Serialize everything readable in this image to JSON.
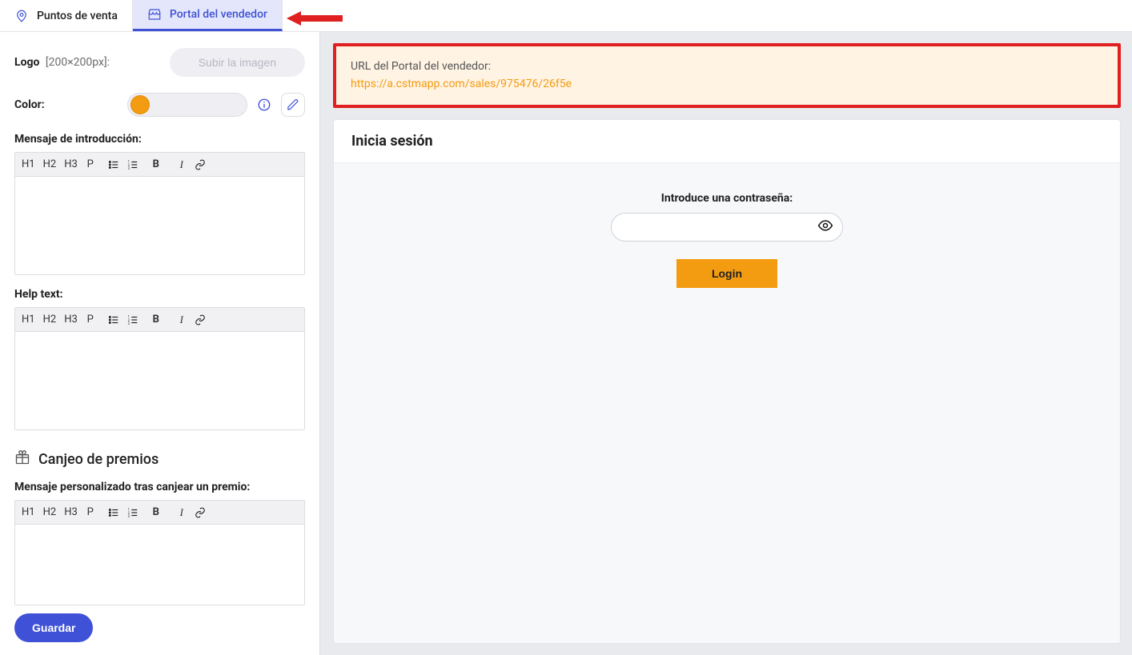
{
  "tabs": {
    "pos": "Puntos de venta",
    "portal": "Portal del vendedor"
  },
  "left": {
    "logo_label": "Logo",
    "logo_size": "[200×200px]:",
    "upload": "Subir la imagen",
    "color_label": "Color:",
    "color_hex": "#f39c12",
    "intro_label": "Mensaje de introducción:",
    "help_label": "Help text:",
    "prizes_heading": "Canjeo de premios",
    "prize_msg_label": "Mensaje personalizado tras canjear un premio:",
    "toolbar": {
      "h1": "H1",
      "h2": "H2",
      "h3": "H3",
      "p": "P",
      "b": "B",
      "i": "I"
    },
    "save": "Guardar"
  },
  "url_box": {
    "title": "URL del Portal del vendedor:",
    "link": "https://a.cstmapp.com/sales/975476/26f5e"
  },
  "preview": {
    "title": "Inicia sesión",
    "password_label": "Introduce una contraseña:",
    "login": "Login"
  }
}
